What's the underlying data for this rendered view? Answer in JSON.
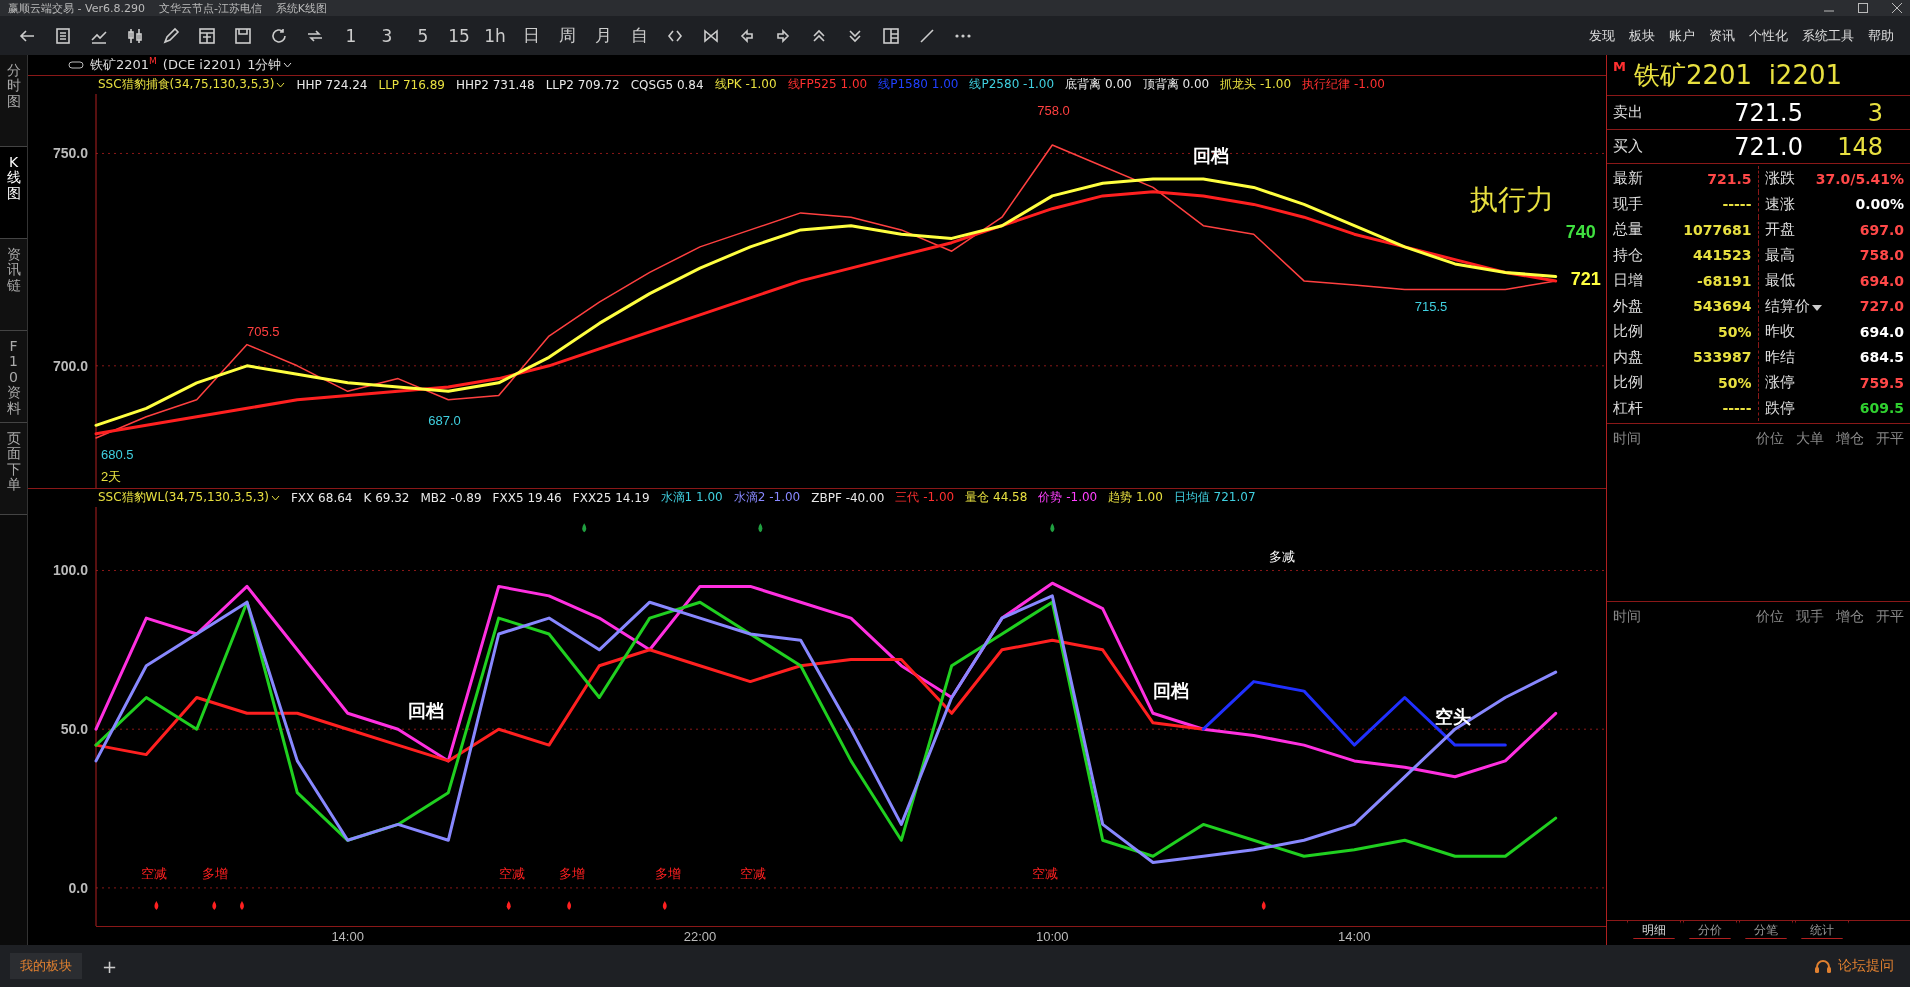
{
  "window": {
    "title": "赢顺云端交易 - Ver6.8.290    文华云节点-江苏电信    系统K线图"
  },
  "toolbar": {
    "periods": [
      "1",
      "3",
      "5",
      "15",
      "1h",
      "日",
      "周",
      "月",
      "自"
    ]
  },
  "menu": [
    "发现",
    "板块",
    "账户",
    "资讯",
    "个性化",
    "系统工具",
    "帮助"
  ],
  "side_tabs": [
    {
      "label": "分时图",
      "selected": false
    },
    {
      "label": "K线图",
      "selected": true
    },
    {
      "label": "资讯链",
      "selected": false
    },
    {
      "label": "F10资料",
      "selected": false
    },
    {
      "label": "页面下单",
      "selected": false
    }
  ],
  "chart_header": {
    "name": "铁矿2201",
    "mark": "M",
    "code": "(DCE i2201)",
    "period": "1分钟"
  },
  "main_indicator": {
    "name": "SSC猎豹捕食(34,75,130,3,5,3)",
    "values": [
      {
        "text": "HHP 724.24",
        "color": "#e8e8e8"
      },
      {
        "text": "LLP 716.89",
        "color": "#e8e040"
      },
      {
        "text": "HHP2 731.48",
        "color": "#e8e8e8"
      },
      {
        "text": "LLP2 709.72",
        "color": "#e8e8e8"
      },
      {
        "text": "CQSG5 0.84",
        "color": "#e8e8e8"
      },
      {
        "text": "线PK -1.00",
        "color": "#e8e040"
      },
      {
        "text": "线FP525 1.00",
        "color": "#ff3030"
      },
      {
        "text": "线P1580 1.00",
        "color": "#2040ff"
      },
      {
        "text": "线P2580 -1.00",
        "color": "#40d0e0"
      },
      {
        "text": "底背离 0.00",
        "color": "#e8e8e8"
      },
      {
        "text": "顶背离 0.00",
        "color": "#e8e8e8"
      },
      {
        "text": "抓龙头 -1.00",
        "color": "#e8e040"
      },
      {
        "text": "执行纪律 -1.00",
        "color": "#ff3030"
      }
    ],
    "chart_data": {
      "type": "line",
      "grid": true,
      "ylim": [
        671,
        764
      ],
      "yticks": [
        {
          "value": 700,
          "label": "700.0"
        },
        {
          "value": 750,
          "label": "750.0"
        }
      ],
      "series": [
        {
          "color": "#ff4040",
          "values": [
            683,
            688,
            692,
            705,
            700,
            694,
            697,
            692,
            693,
            707,
            715,
            722,
            728,
            732,
            736,
            735,
            732,
            727,
            735,
            752,
            747,
            742,
            733,
            731,
            720,
            719,
            718,
            718,
            718,
            720
          ]
        },
        {
          "color": "#ff2020",
          "values": [
            684,
            686,
            688,
            690,
            692,
            693,
            694,
            695,
            697,
            700,
            704,
            708,
            712,
            716,
            720,
            723,
            726,
            729,
            733,
            737,
            740,
            741,
            740,
            738,
            735,
            731,
            728,
            725,
            722,
            720
          ]
        },
        {
          "color": "#ffff40",
          "values": [
            686,
            690,
            696,
            700,
            698,
            696,
            695,
            694,
            696,
            702,
            710,
            717,
            723,
            728,
            732,
            733,
            731,
            730,
            733,
            740,
            743,
            744,
            744,
            742,
            738,
            733,
            728,
            724,
            722,
            721
          ]
        }
      ],
      "annotations": [
        "680.5",
        "2天",
        "705.5",
        "687.0",
        "758.0",
        "715.5",
        "回档",
        "执行力",
        "740",
        "721"
      ]
    }
  },
  "sub_indicator": {
    "name": "SSC猎豹WL(34,75,130,3,5,3)",
    "values": [
      {
        "text": "FXX 68.64",
        "color": "#e8e8e8"
      },
      {
        "text": "K 69.32",
        "color": "#e8e8e8"
      },
      {
        "text": "MB2 -0.89",
        "color": "#e8e8e8"
      },
      {
        "text": "FXX5 19.46",
        "color": "#e8e8e8"
      },
      {
        "text": "FXX25 14.19",
        "color": "#e8e8e8"
      },
      {
        "text": "水滴1 1.00",
        "color": "#40d0e0"
      },
      {
        "text": "水滴2 -1.00",
        "color": "#8888ff"
      },
      {
        "text": "ZBPF -40.00",
        "color": "#e8e8e8"
      },
      {
        "text": "三代 -1.00",
        "color": "#ff3030"
      },
      {
        "text": "量仓 44.58",
        "color": "#e8e040"
      },
      {
        "text": "价势 -1.00",
        "color": "#ff40ff"
      },
      {
        "text": "趋势 1.00",
        "color": "#e8e040"
      },
      {
        "text": "日均值 721.07",
        "color": "#40d0e0"
      }
    ],
    "chart_data": {
      "type": "line",
      "grid": true,
      "ylim": [
        -12,
        120
      ],
      "yticks": [
        {
          "value": 0,
          "label": "0.0"
        },
        {
          "value": 50,
          "label": "50.0"
        },
        {
          "value": 100,
          "label": "100.0"
        }
      ],
      "categories": [
        null,
        null,
        null,
        null,
        null,
        "14:00",
        null,
        null,
        null,
        null,
        null,
        null,
        "22:00",
        null,
        null,
        null,
        null,
        null,
        null,
        "10:00",
        null,
        null,
        null,
        null,
        null,
        "14:00",
        null,
        null,
        null,
        null
      ],
      "series": [
        {
          "color": "#ff30e0",
          "values": [
            50,
            85,
            80,
            95,
            75,
            55,
            50,
            40,
            95,
            92,
            85,
            75,
            95,
            95,
            90,
            85,
            70,
            60,
            85,
            96,
            88,
            55,
            50,
            48,
            45,
            40,
            38,
            35,
            40,
            55
          ]
        },
        {
          "color": "#ff2020",
          "values": [
            45,
            42,
            60,
            55,
            55,
            50,
            45,
            40,
            50,
            45,
            70,
            75,
            70,
            65,
            70,
            72,
            72,
            55,
            75,
            78,
            75,
            52,
            50,
            null,
            null,
            null,
            null,
            null,
            null,
            null
          ]
        },
        {
          "color": "#2030ff",
          "values": [
            null,
            null,
            null,
            null,
            null,
            null,
            null,
            null,
            null,
            null,
            null,
            null,
            null,
            null,
            null,
            null,
            null,
            null,
            null,
            null,
            null,
            null,
            50,
            65,
            62,
            45,
            60,
            45,
            45,
            null
          ]
        },
        {
          "color": "#20d020",
          "values": [
            45,
            60,
            50,
            90,
            30,
            15,
            20,
            30,
            85,
            80,
            60,
            85,
            90,
            80,
            70,
            40,
            15,
            70,
            80,
            90,
            15,
            10,
            20,
            15,
            10,
            12,
            15,
            10,
            10,
            22
          ]
        },
        {
          "color": "#8888ff",
          "values": [
            40,
            70,
            80,
            90,
            40,
            15,
            20,
            15,
            80,
            85,
            75,
            90,
            85,
            80,
            78,
            50,
            20,
            60,
            85,
            92,
            20,
            8,
            10,
            12,
            15,
            20,
            35,
            50,
            60,
            68
          ]
        }
      ],
      "annotations": [
        "回档",
        "回档",
        "多减",
        "空头",
        "空减",
        "多增",
        "空减",
        "多增",
        "多增",
        "空减",
        "空减"
      ]
    }
  },
  "quote": {
    "mark": "M",
    "title": "铁矿2201  i2201",
    "sell": {
      "label": "卖出",
      "price": "721.5",
      "volume": "3"
    },
    "buy": {
      "label": "买入",
      "price": "721.0",
      "volume": "148"
    },
    "rows": [
      [
        {
          "label": "最新",
          "value": "721.5",
          "color": "#ff4848"
        },
        {
          "label": "涨跌",
          "value": "37.0/5.41%",
          "color": "#ff4848"
        }
      ],
      [
        {
          "label": "现手",
          "value": "-----",
          "color": "#e8e040"
        },
        {
          "label": "速涨",
          "value": "0.00%",
          "color": "#ffffff"
        }
      ],
      [
        {
          "label": "总量",
          "value": "1077681",
          "color": "#e8e040"
        },
        {
          "label": "开盘",
          "value": "697.0",
          "color": "#ff4848"
        }
      ],
      [
        {
          "label": "持仓",
          "value": "441523",
          "color": "#e8e040"
        },
        {
          "label": "最高",
          "value": "758.0",
          "color": "#ff4848"
        }
      ],
      [
        {
          "label": "日增",
          "value": "-68191",
          "color": "#e8e040"
        },
        {
          "label": "最低",
          "value": "694.0",
          "color": "#ff4848"
        }
      ],
      [
        {
          "label": "外盘",
          "value": "543694",
          "color": "#e8e040"
        },
        {
          "label": "结算价",
          "value": "727.0",
          "color": "#ff4848",
          "dropdown": true
        }
      ],
      [
        {
          "label": "比例",
          "value": "50%",
          "color": "#e8e040"
        },
        {
          "label": "昨收",
          "value": "694.0",
          "color": "#ffffff"
        }
      ],
      [
        {
          "label": "内盘",
          "value": "533987",
          "color": "#e8e040"
        },
        {
          "label": "昨结",
          "value": "684.5",
          "color": "#ffffff"
        }
      ],
      [
        {
          "label": "比例",
          "value": "50%",
          "color": "#e8e040"
        },
        {
          "label": "涨停",
          "value": "759.5",
          "color": "#ff4848"
        }
      ],
      [
        {
          "label": "杠杆",
          "value": "-----",
          "color": "#e8e040"
        },
        {
          "label": "跌停",
          "value": "609.5",
          "color": "#30d030"
        }
      ]
    ]
  },
  "trades_big": {
    "columns": [
      "时间",
      "价位",
      "大单",
      "增仓",
      "开平"
    ]
  },
  "trades": {
    "columns": [
      "时间",
      "价位",
      "现手",
      "增仓",
      "开平"
    ]
  },
  "panel_tabs": [
    {
      "label": "明细",
      "selected": true
    },
    {
      "label": "分价",
      "selected": false
    },
    {
      "label": "分笔",
      "selected": false
    },
    {
      "label": "统计",
      "selected": false
    }
  ],
  "status_bar": {
    "tab": "我的板块",
    "add": "+",
    "help": "论坛提问"
  }
}
